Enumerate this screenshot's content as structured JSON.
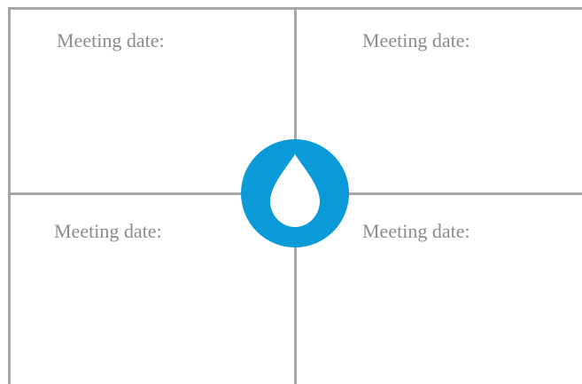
{
  "quadrants": [
    {
      "label": "Meeting date:"
    },
    {
      "label": "Meeting date:"
    },
    {
      "label": "Meeting date:"
    },
    {
      "label": "Meeting date:"
    }
  ],
  "logo": {
    "icon": "water-drop-icon",
    "circle_color": "#0b9ad8",
    "drop_color": "#ffffff"
  },
  "colors": {
    "grid_line": "#a6a6a6",
    "label_text": "#8c8c8c"
  }
}
